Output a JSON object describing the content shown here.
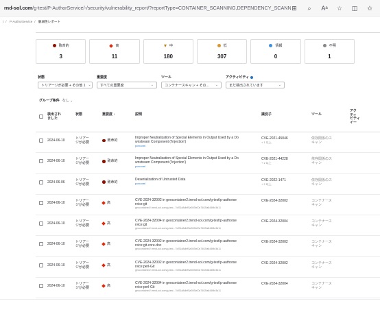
{
  "browser": {
    "url_host": "rnd-sol.com",
    "url_path": "/g-test/P-AuthorService/-/security/vulnerability_report/?reportType=CONTAINER_SCANNING,DEPENDENCY_SCANNIN...",
    "icons": [
      "grid-icon",
      "zoom-icon",
      "read-aloud-icon",
      "favorite-star-icon",
      "split-screen-icon",
      "favorites-icon",
      "extensions-icon"
    ]
  },
  "breadcrumb": [
    "t",
    "P-AuthorService",
    "脆弱性レポート"
  ],
  "severity_cards": [
    {
      "label": "致命的",
      "count": "3",
      "color": "#8d1300",
      "shape": "dot"
    },
    {
      "label": "高",
      "count": "11",
      "color": "#dd2b0e",
      "shape": "diamond"
    },
    {
      "label": "中",
      "count": "180",
      "color": "#c17d10",
      "shape": "triangle"
    },
    {
      "label": "低",
      "count": "307",
      "color": "#d99530",
      "shape": "dot"
    },
    {
      "label": "情報",
      "count": "0",
      "color": "#428fdc",
      "shape": "dot"
    },
    {
      "label": "不明",
      "count": "1",
      "color": "#868686",
      "shape": "dot"
    }
  ],
  "filters": [
    {
      "label": "状態",
      "value": "トリアージが必要 + その他 1"
    },
    {
      "label": "重要度",
      "value": "すべての重要度"
    },
    {
      "label": "ツール",
      "value": "コンテナースキャン + その..."
    },
    {
      "label": "アクティビティ",
      "value": "まだ検出されています"
    }
  ],
  "group_by": {
    "label": "グループ条件",
    "value": "なし"
  },
  "table": {
    "headers": {
      "detected": "検出され\nました",
      "status": "状態",
      "severity": "重要度 ↓",
      "description": "説明",
      "identifier": "識別子",
      "tool": "ツール",
      "activity": "アク\nティ\nビティ\nイー"
    },
    "rows": [
      {
        "date": "2024-06-10",
        "status": "トリアー\nジが必要",
        "severity": "致命的",
        "sev_color": "#8d1300",
        "sev_shape": "dot",
        "title": "Improper Neutralization of Special Elements in Output Used by a Do\nwnstream Component ('Injection')",
        "sub": "pom.xml",
        "sub_is_link": true,
        "id": "CVE-2021-45046",
        "id_sub": "+ 1 以上",
        "tool": "依存関係のス\nキャン"
      },
      {
        "date": "2024-06-10",
        "status": "トリアー\nジが必要",
        "severity": "致命的",
        "sev_color": "#8d1300",
        "sev_shape": "dot",
        "title": "Improper Neutralization of Special Elements in Output Used by a Do\nwnstream Component ('Injection')",
        "sub": "pom.xml",
        "sub_is_link": true,
        "id": "CVE-2021-44228",
        "id_sub": "+ 2 以上",
        "tool": "依存関係のス\nキャン"
      },
      {
        "date": "2024-06-06",
        "status": "トリアー\nジが必要",
        "severity": "致命的",
        "sev_color": "#8d1300",
        "sev_shape": "dot",
        "title": "Deserialization of Untrusted Data",
        "sub": "pom.xml",
        "sub_is_link": true,
        "id": "CVE-2022-1471",
        "id_sub": "+ 2 以上",
        "tool": "依存関係のス\nキャン"
      },
      {
        "date": "2024-06-10",
        "status": "トリアー\nジが必要",
        "severity": "高",
        "sev_color": "#dd2b0e",
        "sev_shape": "diamond",
        "title": "CVE-2024-32002 in geocontainer2.trend-sol.com/g-test/p-authorse\nrvice:git",
        "sub": "geocontainer2.trend-sol.com/g-test...7df31d8dbff3a393b00c7402fa844f8e3d11",
        "sub_is_link": false,
        "id": "CVE-2024-32002",
        "id_sub": "",
        "tool": "コンテナース\nキャン"
      },
      {
        "date": "2024-06-10",
        "status": "トリアー\nジが必要",
        "severity": "高",
        "sev_color": "#dd2b0e",
        "sev_shape": "diamond",
        "title": "CVE-2024-32004 in geocontainer2.trend-sol.com/g-test/p-authorse\nrvice:git",
        "sub": "geocontainer2.trend-sol.com/g-test...7df31d8dbff3a393b00c7402fa844f8e3d11",
        "sub_is_link": false,
        "id": "CVE-2024-32004",
        "id_sub": "",
        "tool": "コンテナース\nキャン"
      },
      {
        "date": "2024-06-10",
        "status": "トリアー\nジが必要",
        "severity": "高",
        "sev_color": "#dd2b0e",
        "sev_shape": "diamond",
        "title": "CVE-2024-32002 in geocontainer2.trend-sol.com/g-test/p-authorse\nrvice:git-core-doc",
        "sub": "geocontainer2.trend-sol.com/g-test...7df31d8dbff3a393b00c7402fa844f8e3d11",
        "sub_is_link": false,
        "id": "CVE-2024-32002",
        "id_sub": "",
        "tool": "コンテナース\nキャン"
      },
      {
        "date": "2024-06-10",
        "status": "トリアー\nジが必要",
        "severity": "高",
        "sev_color": "#dd2b0e",
        "sev_shape": "diamond",
        "title": "CVE-2024-32002 in geocontainer2.trend-sol.com/g-test/p-authorse\nrvice:perl-Git",
        "sub": "geocontainer2.trend-sol.com/g-test...7df31d8dbff3a393b00c7402fa844f8e3d11",
        "sub_is_link": false,
        "id": "CVE-2024-32002",
        "id_sub": "",
        "tool": "コンテナース\nキャン"
      },
      {
        "date": "2024-06-10",
        "status": "トリアー\nジが必要",
        "severity": "高",
        "sev_color": "#dd2b0e",
        "sev_shape": "diamond",
        "title": "CVE-2024-32004 in geocontainer2.trend-sol.com/g-test/p-authorse\nrvice:perl-Git",
        "sub": "geocontainer2.trend-sol.com/g-test...7df31d8dbff3a393b00c7402fa844f8e3d11",
        "sub_is_link": false,
        "id": "CVE-2024-32004",
        "id_sub": "",
        "tool": "コンテナース\nキャン"
      }
    ]
  }
}
